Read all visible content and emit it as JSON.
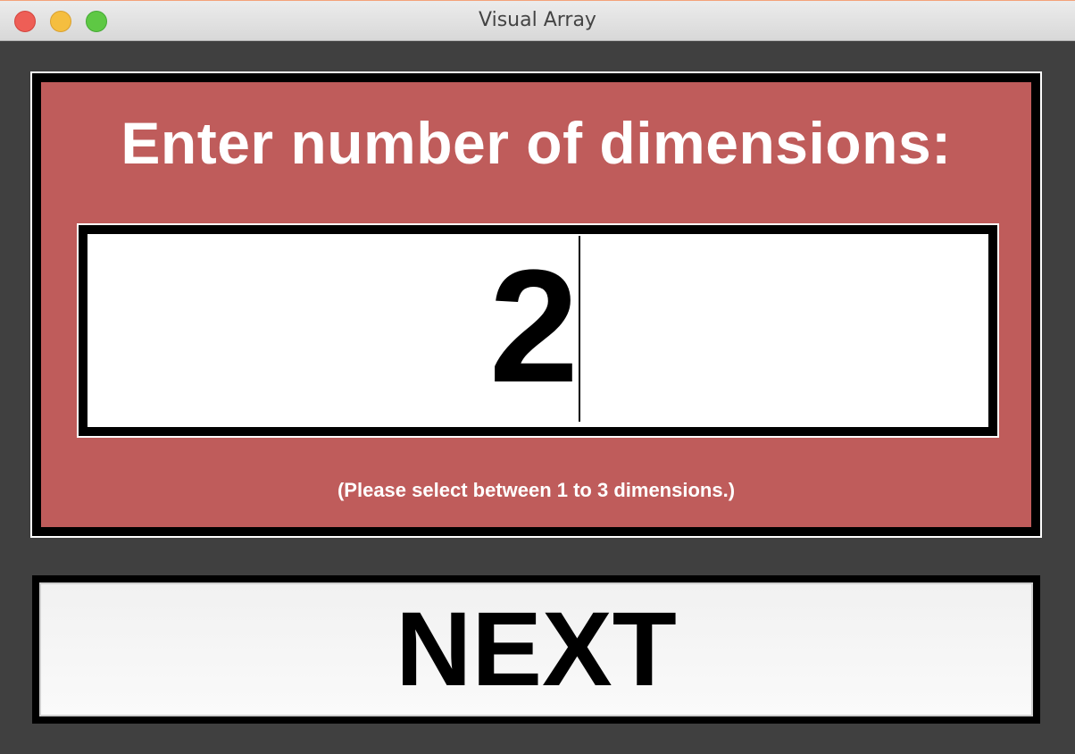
{
  "window": {
    "title": "Visual Array"
  },
  "prompt": {
    "heading": "Enter number of dimensions:",
    "field_value": "2",
    "hint": "(Please select between 1 to 3 dimensions.)"
  },
  "actions": {
    "next_label": "NEXT"
  },
  "colors": {
    "panel_background": "#bf5c5b",
    "window_background": "#404040",
    "field_background": "#ffffff"
  }
}
